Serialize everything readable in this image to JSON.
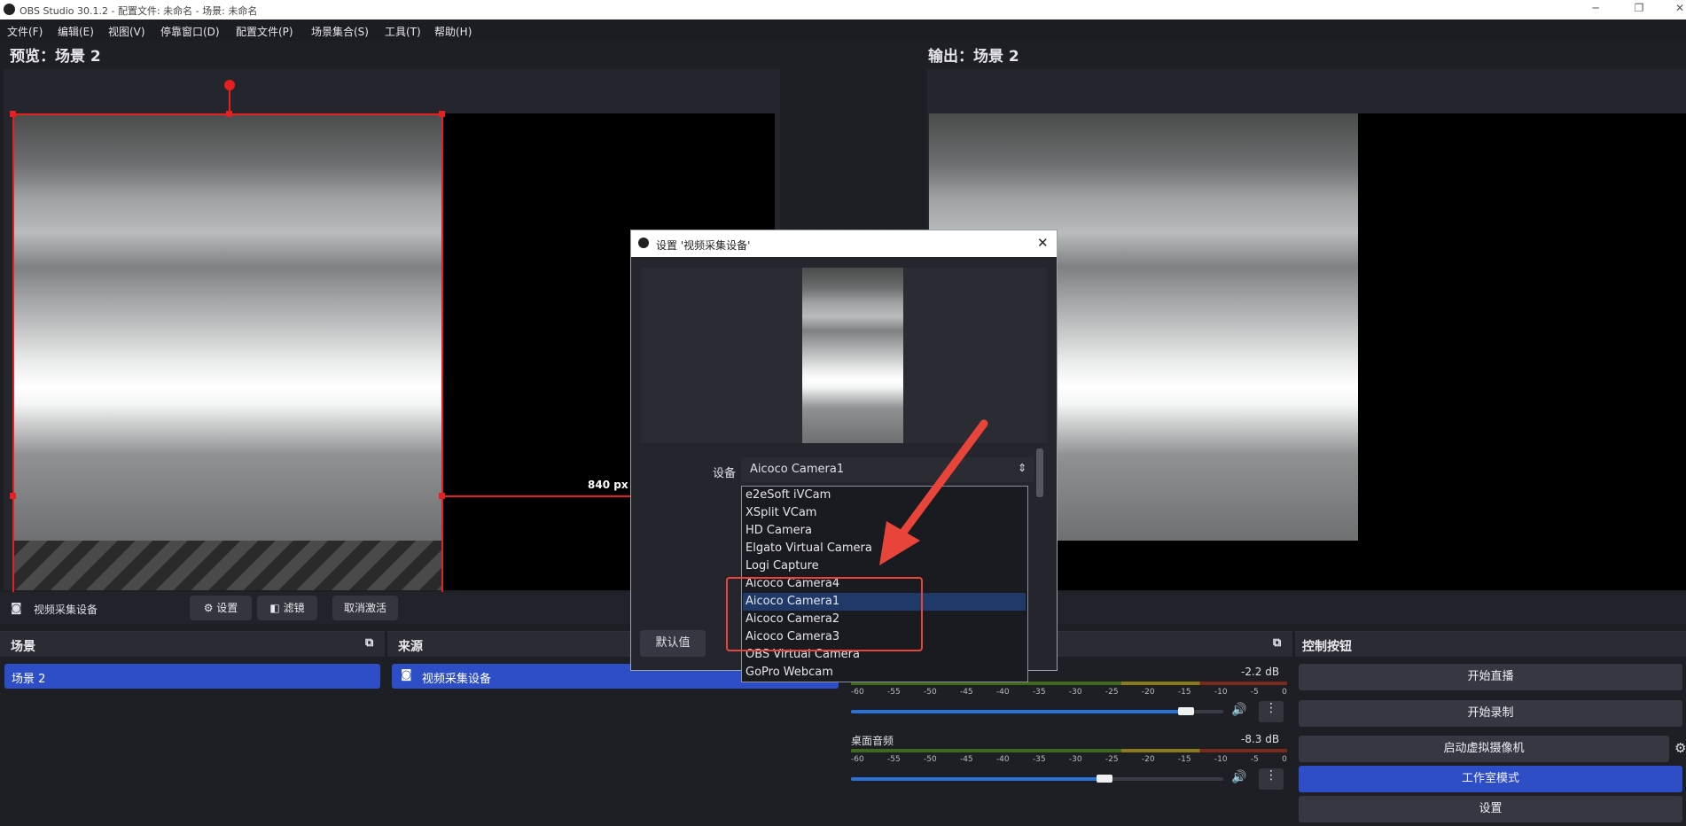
{
  "window": {
    "title": "OBS Studio 30.1.2 - 配置文件: 未命名 - 场景: 未命名"
  },
  "menu": [
    "文件(F)",
    "编辑(E)",
    "视图(V)",
    "停靠窗口(D)",
    "配置文件(P)",
    "场景集合(S)",
    "工具(T)",
    "帮助(H)"
  ],
  "preview": {
    "title": "预览：场景 2",
    "size_label": "840 px"
  },
  "program": {
    "title": "输出：场景 2"
  },
  "source_toolbar": {
    "source_name": "视频采集设备",
    "settings": "设置",
    "filters": "滤镜",
    "deactivate": "取消激活"
  },
  "scenes": {
    "title": "场景",
    "items": [
      "场景 2"
    ]
  },
  "sources": {
    "title": "来源",
    "items": [
      "视频采集设备"
    ]
  },
  "mixer": {
    "scale": [
      "-60",
      "-55",
      "-50",
      "-45",
      "-40",
      "-35",
      "-30",
      "-25",
      "-20",
      "-15",
      "-10",
      "-5",
      "0"
    ],
    "channels": [
      {
        "name": "",
        "db": "-2.2 dB",
        "level": 0.9
      },
      {
        "name": "桌面音频",
        "db": "-8.3 dB",
        "level": 0.68
      }
    ]
  },
  "controls": {
    "title": "控制按钮",
    "start_stream": "开始直播",
    "start_record": "开始录制",
    "virtual_cam": "启动虚拟摄像机",
    "studio_mode": "工作室模式",
    "settings": "设置"
  },
  "dialog": {
    "title": "设置 '视频采集设备'",
    "device_label": "设备",
    "device_value": "Aicoco Camera1",
    "defaults_button": "默认值",
    "devices": [
      "e2eSoft iVCam",
      "XSplit VCam",
      "HD Camera",
      "Elgato Virtual Camera",
      "Logi Capture",
      "Aicoco Camera4",
      "Aicoco Camera1",
      "Aicoco Camera2",
      "Aicoco Camera3",
      "OBS Virtual Camera",
      "GoPro Webcam"
    ],
    "selected_index": 6
  },
  "colors": {
    "accent": "#2e4ec7",
    "selection_red": "#e62020",
    "annotation_red": "#e8443a"
  }
}
